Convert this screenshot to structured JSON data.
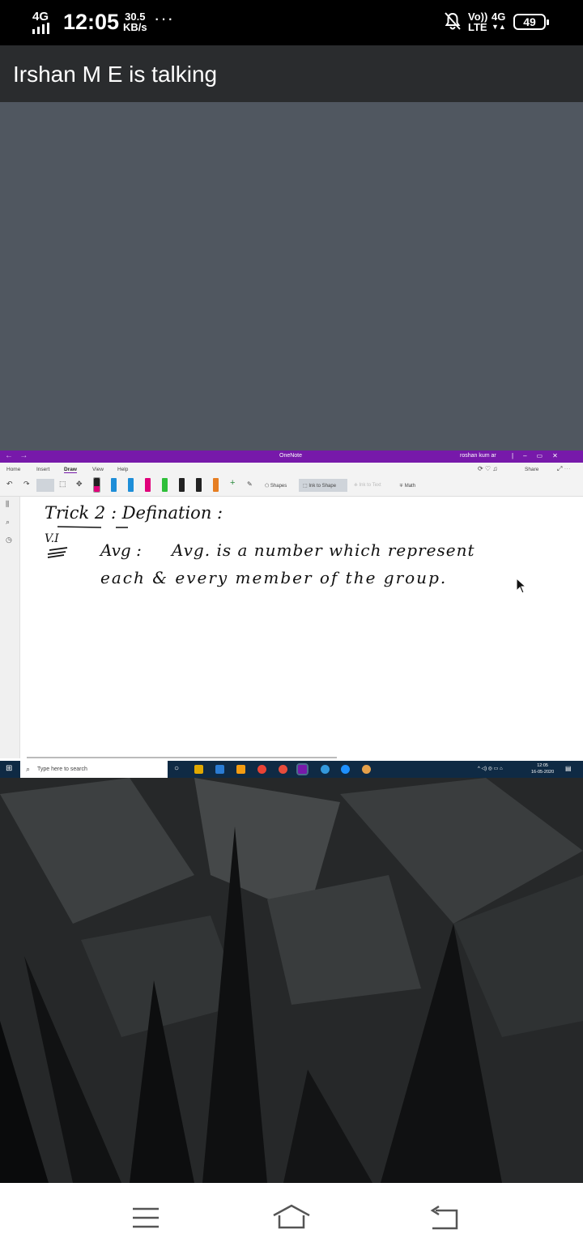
{
  "status_bar": {
    "network": "4G",
    "time": "12:05",
    "speed_value": "30.5",
    "speed_unit": "KB/s",
    "more": "···",
    "volte": "Vo))",
    "lte": "LTE",
    "data_type": "4G",
    "battery": "49"
  },
  "call_banner": {
    "text": "Irshan M E is talking"
  },
  "onenote": {
    "app_title": "OneNote",
    "user": "roshan kum ar",
    "tabs": [
      "Home",
      "Insert",
      "Draw",
      "View",
      "Help"
    ],
    "active_tab": "Draw",
    "share_label": "Share",
    "tools": {
      "shapes": "Shapes",
      "ink_to_shape": "Ink to Shape",
      "ink_to_text": "Ink to Text",
      "math": "Math"
    },
    "pen_colors": [
      "#222222",
      "#1e8ed8",
      "#1e8ed8",
      "#e0007a",
      "#e6007e",
      "#2fbf3a",
      "#222222",
      "#222222",
      "#e67e22"
    ],
    "note": {
      "line1_left": "Trick 2 : Defination :",
      "vi_mark": "V.I",
      "line2_label": "Avg :",
      "line2_text": "Avg.  is  a  number which represent",
      "line3_text": "each & every member of the group."
    }
  },
  "taskbar": {
    "search_placeholder": "Type here to search",
    "clock_time": "12:05",
    "clock_date": "16-05-2020",
    "app_colors": [
      "#e0a800",
      "#2b7cd3",
      "#e74c3c",
      "#f39c12",
      "#ea4335",
      "#7719aa",
      "#3498db",
      "#1e90ff",
      "#e5a04a"
    ]
  },
  "nav_bar": {
    "menu_icon": "menu-icon",
    "home_icon": "home-icon",
    "back_icon": "back-icon"
  }
}
